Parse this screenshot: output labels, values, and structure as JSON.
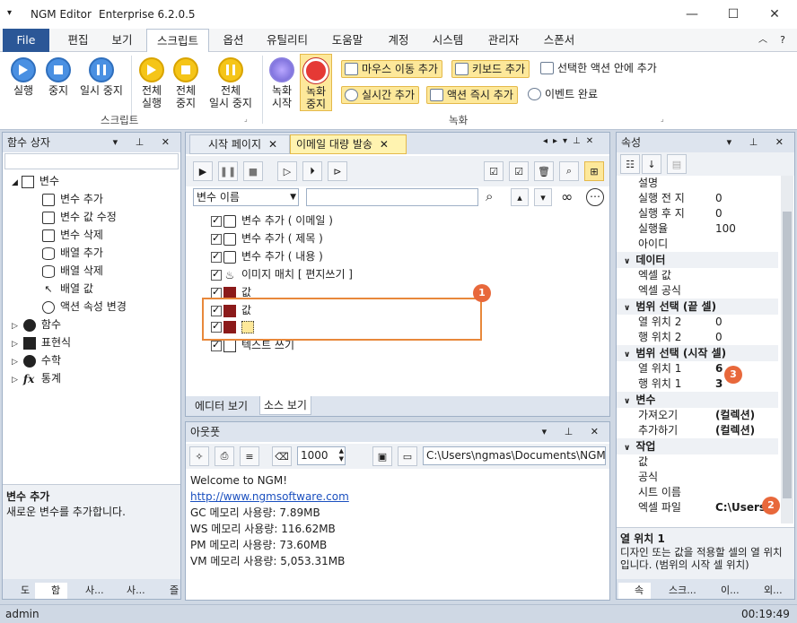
{
  "window": {
    "app_title": "NGM Editor",
    "edition": "Enterprise 6.2.0.5"
  },
  "menu": {
    "file": "File",
    "items": [
      "편집",
      "보기",
      "스크립트",
      "옵션",
      "유틸리티",
      "도움말",
      "계정",
      "시스템",
      "관리자",
      "스폰서"
    ],
    "active": "스크립트"
  },
  "ribbon": {
    "script_group": {
      "label": "스크립트",
      "run": "실행",
      "stop": "중지",
      "pause": "일시 중지",
      "run_all_1": "전체",
      "run_all_2": "실행",
      "stop_all_1": "전체",
      "stop_all_2": "중지",
      "pause_all_1": "전체",
      "pause_all_2": "일시 중지"
    },
    "record_group": {
      "label": "녹화",
      "record_start_1": "녹화",
      "record_start_2": "시작",
      "record_stop_1": "녹화",
      "record_stop_2": "중지",
      "mouse_move_add": "마우스 이동 추가",
      "keyboard_add": "키보드 추가",
      "in_selected_action": "선택한 액션 안에 추가",
      "realtime_add": "실시간 추가",
      "action_immediate_add": "액션 즉시 추가",
      "event_complete": "이벤트 완료"
    }
  },
  "function_box": {
    "title": "함수 상자",
    "variable": "변수",
    "var_items": [
      "변수 추가",
      "변수 값 수정",
      "변수 삭제",
      "배열 추가",
      "배열 삭제",
      "배열 값",
      "액션 속성 변경"
    ],
    "other_groups": [
      "함수",
      "표현식",
      "수학",
      "통계"
    ],
    "desc_title": "변수 추가",
    "desc_text": "새로운 변수를 추가합니다.",
    "bottom_tabs": [
      "도",
      "함",
      "사...",
      "사...",
      "즐"
    ]
  },
  "editor": {
    "tabs": [
      "시작 페이지",
      "이메일 대량 발송"
    ],
    "filter_select": "변수 이름",
    "actions": [
      "변수 추가 ( 이메일 )",
      "변수 추가 ( 제목 )",
      "변수 추가 ( 내용 )",
      "이미지 매치 [ 편지쓰기 ]",
      "값",
      "값",
      "",
      "텍스트 쓰기"
    ],
    "view_tabs": [
      "에디터 보기",
      "소스 보기"
    ]
  },
  "output": {
    "title": "아웃풋",
    "count": "1000",
    "path": "C:\\Users\\ngmas\\Documents\\NGM6\\",
    "lines": {
      "welcome": "Welcome to NGM!",
      "link": "http://www.ngmsoftware.com",
      "gc": "GC 메모리 사용량: 7.89MB",
      "ws": "WS 메모리 사용량: 116.62MB",
      "pm": "PM 메모리 사용량: 73.60MB",
      "vm": "VM 메모리 사용량: 5,053.31MB"
    }
  },
  "properties": {
    "title": "속성",
    "rows_top": [
      {
        "name": "설명",
        "value": ""
      },
      {
        "name": "실행 전 지",
        "value": "0"
      },
      {
        "name": "실행 후 지",
        "value": "0"
      },
      {
        "name": "실행율",
        "value": "100"
      },
      {
        "name": "아이디",
        "value": ""
      }
    ],
    "cat_data": "데이터",
    "data_rows": [
      {
        "name": "엑셀 값",
        "value": ""
      },
      {
        "name": "엑셀 공식",
        "value": ""
      }
    ],
    "cat_range_end": "범위 선택 (끝 셀)",
    "range_end_rows": [
      {
        "name": "열 위치 2",
        "value": "0"
      },
      {
        "name": "행 위치 2",
        "value": "0"
      }
    ],
    "cat_range_start": "범위 선택 (시작 셀)",
    "range_start_rows": [
      {
        "name": "열 위치 1",
        "value": "6"
      },
      {
        "name": "행 위치 1",
        "value": "3"
      }
    ],
    "cat_variable": "변수",
    "variable_rows": [
      {
        "name": "가져오기",
        "value": "(컬렉션)"
      },
      {
        "name": "추가하기",
        "value": "(컬렉션)"
      }
    ],
    "cat_task": "작업",
    "task_rows": [
      {
        "name": "값",
        "value": ""
      },
      {
        "name": "공식",
        "value": ""
      },
      {
        "name": "시트 이름",
        "value": ""
      },
      {
        "name": "엑셀 파일",
        "value": "C:\\Users\\"
      }
    ],
    "desc_title": "열 위치 1",
    "desc_text": "디자인 또는 값을 적용할 셀의 열 위치입니다. (범위의 시작 셀 위치)",
    "bottom_tabs": [
      "속",
      "스크...",
      "이...",
      "외..."
    ]
  },
  "badges": [
    "1",
    "2",
    "3"
  ],
  "status": {
    "user": "admin",
    "time": "00:19:49"
  }
}
